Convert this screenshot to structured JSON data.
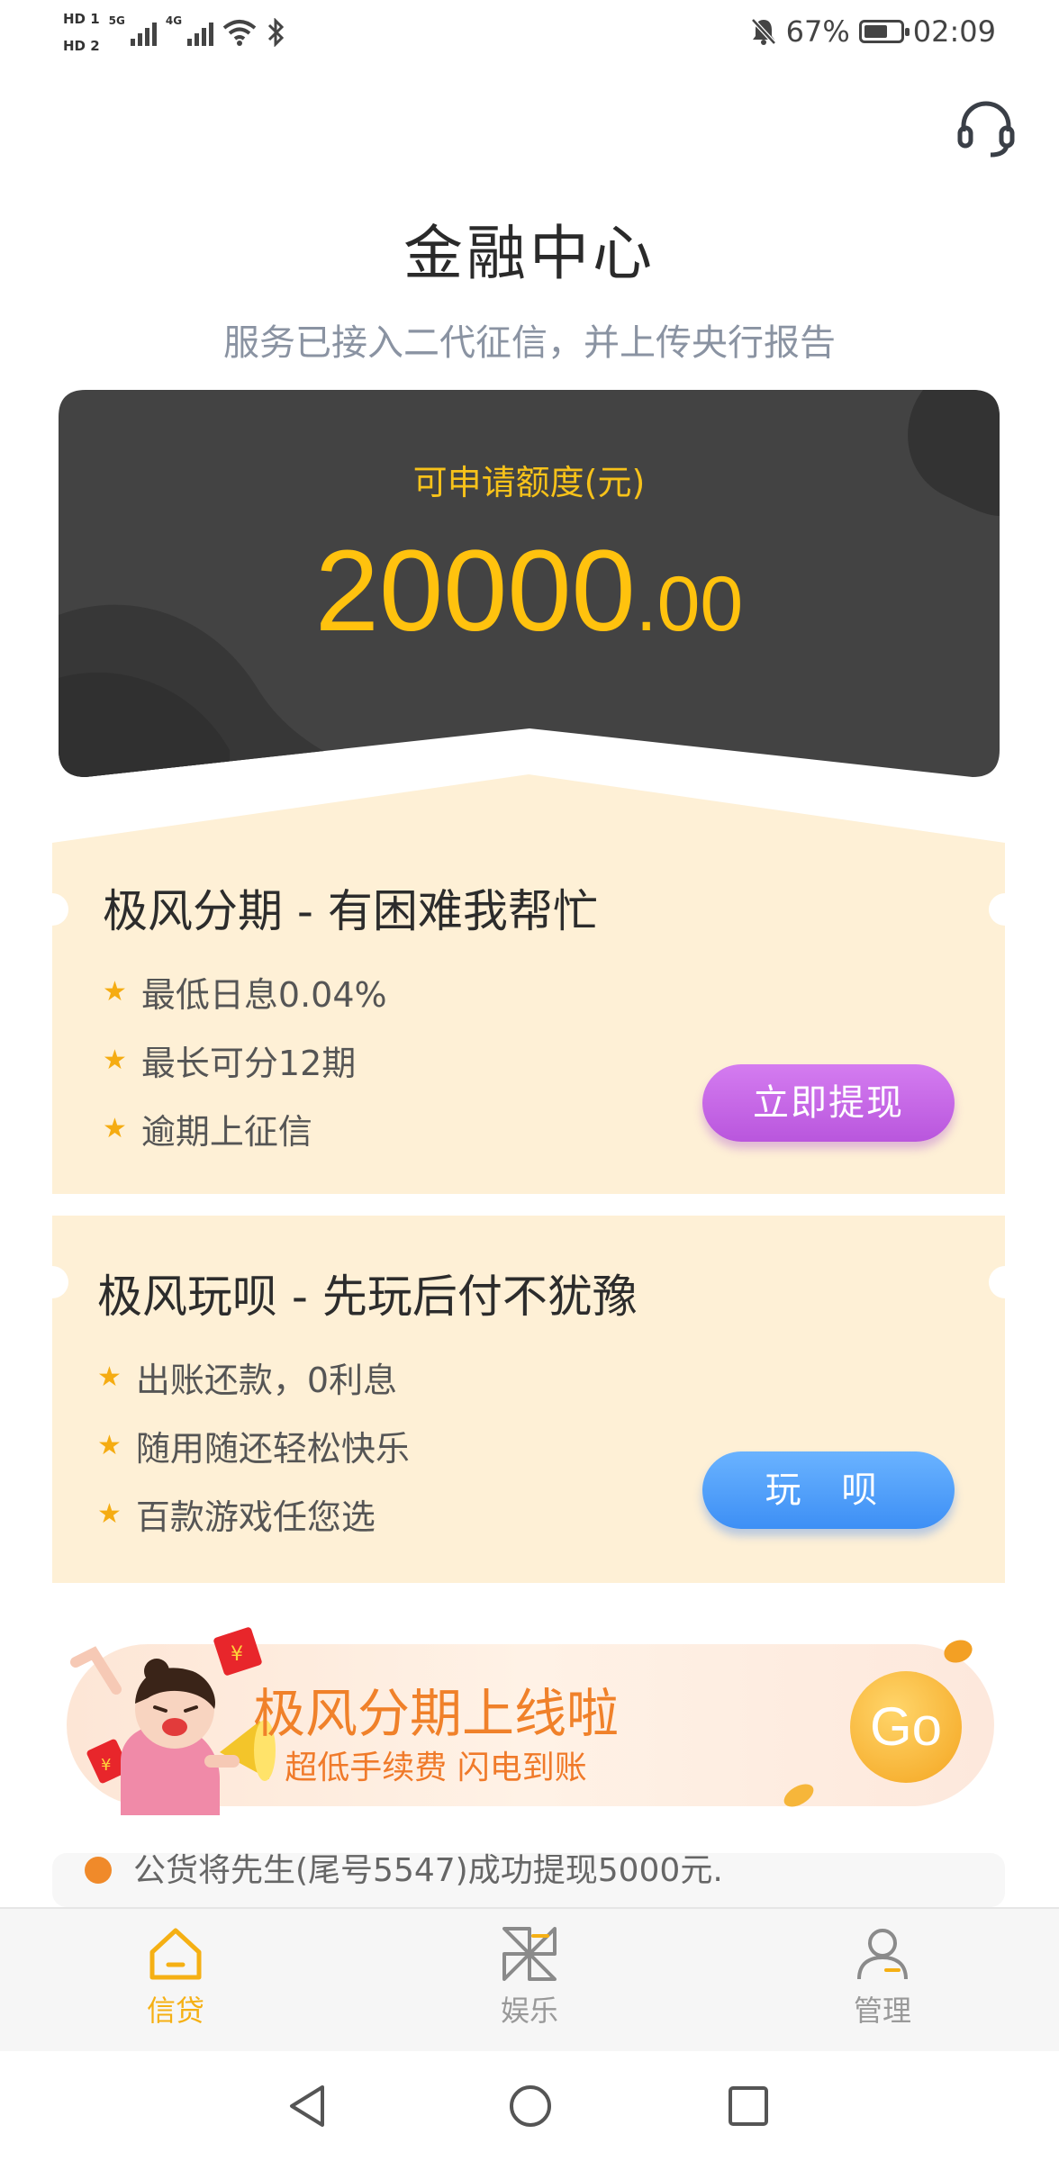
{
  "status_bar": {
    "sim1": "HD 1",
    "sim2": "HD 2",
    "net1": "5G",
    "net2": "4G",
    "battery": "67%",
    "battery_level": 0.67,
    "time": "02:09"
  },
  "header": {
    "title": "金融中心",
    "subtitle": "服务已接入二代征信，并上传央行报告"
  },
  "credit": {
    "label": "可申请额度(元)",
    "amount_integer": "20000",
    "amount_decimal": ".00"
  },
  "products": [
    {
      "title": "极风分期 - 有困难我帮忙",
      "features": [
        "最低日息0.04%",
        "最长可分12期",
        "逾期上征信"
      ],
      "button": "立即提现"
    },
    {
      "title": "极风玩呗 - 先玩后付不犹豫",
      "features": [
        "出账还款，0利息",
        "随用随还轻松快乐",
        "百款游戏任您选"
      ],
      "button": "玩 呗"
    }
  ],
  "banner": {
    "title": "极风分期上线啦",
    "subtitle": "超低手续费 闪电到账",
    "go": "Go"
  },
  "notice": {
    "text": "公货将先生(尾号5547)成功提现5000元."
  },
  "tabs": [
    {
      "label": "信贷",
      "active": true
    },
    {
      "label": "娱乐",
      "active": false
    },
    {
      "label": "管理",
      "active": false
    }
  ],
  "colors": {
    "accent": "#f5b014",
    "amount": "#ffc20e",
    "card_bg": "#434343",
    "panel_bg": "#fef0d6",
    "purple_button": "#c865e8",
    "blue_button": "#4f9ef8",
    "banner_text": "#f0812a"
  }
}
